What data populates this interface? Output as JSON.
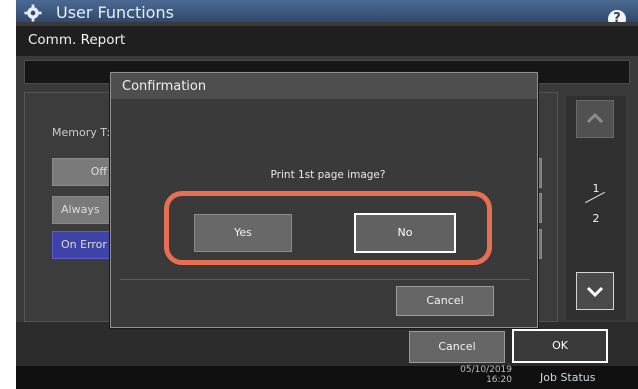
{
  "window": {
    "title": "User Functions",
    "help_icon": "help-icon",
    "help_label": "?",
    "settings_icon": "gear-icon"
  },
  "panel": {
    "title": "Comm. Report",
    "section_label": "Memory Tx",
    "options": [
      {
        "label": "Off"
      },
      {
        "label": "Always"
      },
      {
        "label": "On Error"
      }
    ],
    "page": {
      "current": "1",
      "total": "2"
    }
  },
  "footer": {
    "cancel_label": "Cancel",
    "ok_label": "OK",
    "datetime_line1": "05/10/2019",
    "datetime_line2": "16:20",
    "job_status_label": "Job Status"
  },
  "dialog": {
    "title": "Confirmation",
    "message": "Print 1st page image?",
    "yes_label": "Yes",
    "no_label": "No",
    "cancel_label": "Cancel"
  },
  "colors": {
    "highlight": "#e96f52",
    "title_bar": "#30496b",
    "selected_option": "#3f42a6"
  }
}
